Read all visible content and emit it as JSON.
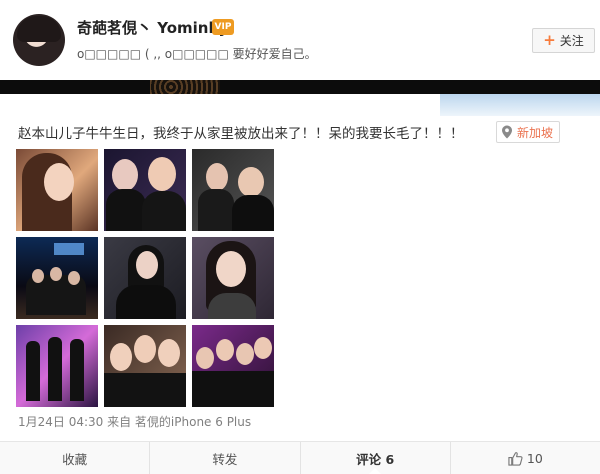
{
  "header": {
    "username": "奇葩茗俔丶 Yominky",
    "vip_badge": "VIP",
    "bio": "o□□□□□ ( ,, o□□□□□ 要好好爱自己。",
    "follow_label": "关注",
    "follow_icon": "plus-icon"
  },
  "post": {
    "text": "赵本山儿子牛牛生日，我终于从家里被放出来了！！呆的我要长毛了！！！",
    "location": "新加坡",
    "location_icon": "location-pin-icon",
    "photo_count": 9,
    "meta": "1月24日 04:30 来自 茗俔的iPhone 6 Plus"
  },
  "actions": {
    "favorite": "收藏",
    "repost": "转发",
    "comment": "评论 6",
    "like_count": "10",
    "like_icon": "thumbs-up-icon"
  },
  "colors": {
    "accent": "#eb7350",
    "follow_plus": "#f77c3d",
    "vip": "#ee9b22",
    "band": "#0c0c0c"
  }
}
